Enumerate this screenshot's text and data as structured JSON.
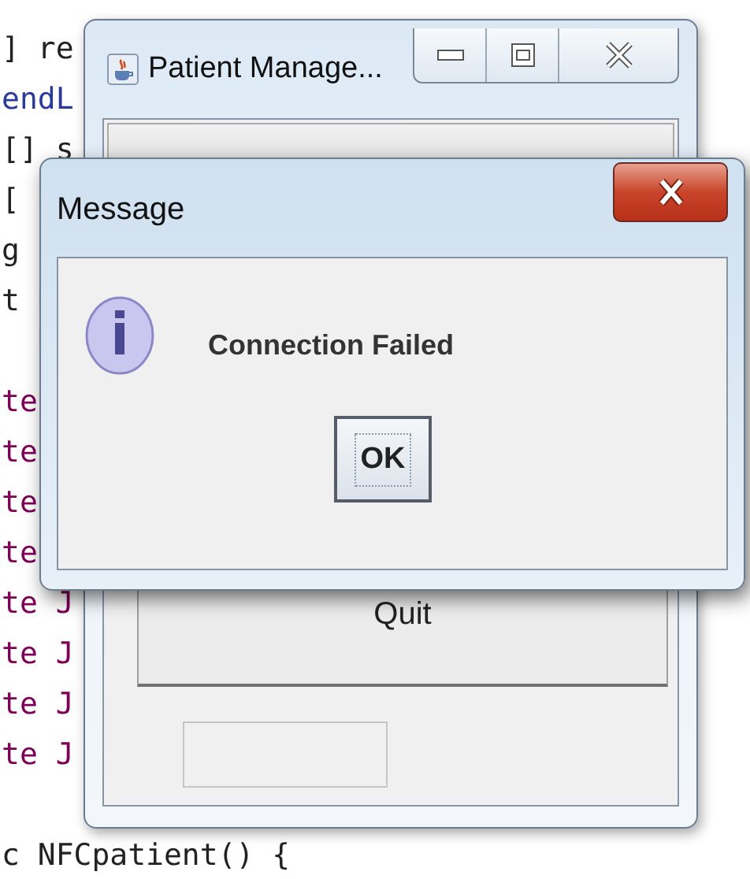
{
  "code_lines": [
    {
      "kind": "plain",
      "text": "] re"
    },
    {
      "kind": "type",
      "text": "endL"
    },
    {
      "kind": "plain",
      "text": "[] s"
    },
    {
      "kind": "plain",
      "text": "["
    },
    {
      "kind": "plain",
      "text": "g"
    },
    {
      "kind": "plain",
      "text": "t"
    },
    {
      "kind": "blank"
    },
    {
      "kind": "keyword",
      "text": "te"
    },
    {
      "kind": "keyword",
      "text": "te"
    },
    {
      "kind": "keyword",
      "text": "te"
    },
    {
      "kind": "keyword",
      "text": "te"
    },
    {
      "kind": "keyword",
      "text": "te J"
    },
    {
      "kind": "keyword",
      "text": "te J"
    },
    {
      "kind": "keyword",
      "text": "te J"
    },
    {
      "kind": "keyword",
      "text": "te J"
    },
    {
      "kind": "blank"
    },
    {
      "kind": "plain",
      "text": "c NFCpatient() {"
    }
  ],
  "main_window": {
    "title": "Patient Manage...",
    "quit_button": "Quit"
  },
  "dialog": {
    "title": "Message",
    "message": "Connection Failed",
    "button": "OK",
    "button_focused": true
  }
}
